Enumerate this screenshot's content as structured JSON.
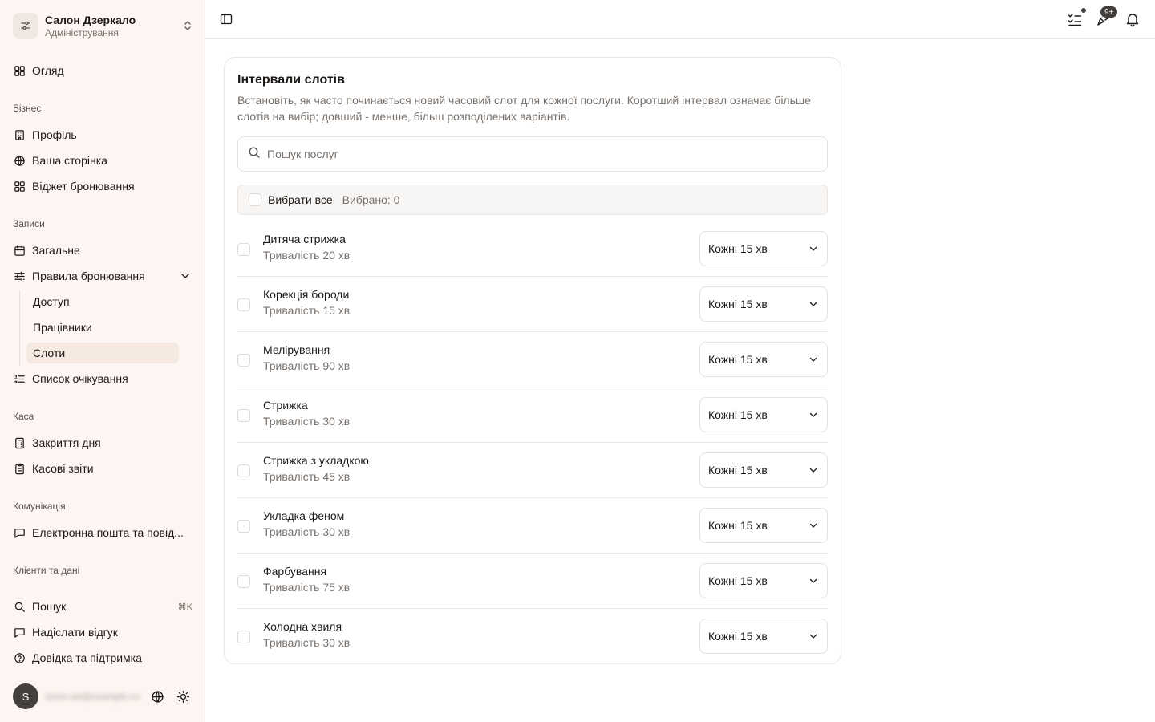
{
  "org": {
    "name": "Салон Дзеркало",
    "subtitle": "Адміністрування"
  },
  "nav": {
    "overview": "Огляд",
    "section_business": "Бізнес",
    "profile": "Профіль",
    "your_page": "Ваша сторінка",
    "booking_widget": "Віджет бронювання",
    "section_bookings": "Записи",
    "general": "Загальне",
    "booking_rules": "Правила бронювання",
    "sub_access": "Доступ",
    "sub_workers": "Працівники",
    "sub_slots": "Слоти",
    "waitlist": "Список очікування",
    "section_cash": "Каса",
    "day_close": "Закриття дня",
    "cash_reports": "Касові звіти",
    "section_comms": "Комунікація",
    "email": "Електронна пошта та повід...",
    "section_clients": "Клієнти та дані",
    "search": "Пошук",
    "search_kbd": "⌘K",
    "feedback": "Надіслати відгук",
    "help": "Довідка та підтримка"
  },
  "user": {
    "initial": "S",
    "email": "stoss-ad@example.com"
  },
  "topbar": {
    "badge": "9+"
  },
  "card": {
    "title": "Інтервали слотів",
    "description": "Встановіть, як часто починається новий часовий слот для кожної послуги. Коротший інтервал означає більше слотів на вибір; довший - менше, більш розподілених варіантів.",
    "search_placeholder": "Пошук послуг",
    "select_all": "Вибрати все",
    "selected_count": "Вибрано: 0"
  },
  "services": [
    {
      "name": "Дитяча стрижка",
      "duration": "Тривалість 20 хв",
      "interval": "Кожні 15 хв"
    },
    {
      "name": "Корекція бороди",
      "duration": "Тривалість 15 хв",
      "interval": "Кожні 15 хв"
    },
    {
      "name": "Мелірування",
      "duration": "Тривалість 90 хв",
      "interval": "Кожні 15 хв"
    },
    {
      "name": "Стрижка",
      "duration": "Тривалість 30 хв",
      "interval": "Кожні 15 хв"
    },
    {
      "name": "Стрижка з укладкою",
      "duration": "Тривалість 45 хв",
      "interval": "Кожні 15 хв"
    },
    {
      "name": "Укладка феном",
      "duration": "Тривалість 30 хв",
      "interval": "Кожні 15 хв"
    },
    {
      "name": "Фарбування",
      "duration": "Тривалість 75 хв",
      "interval": "Кожні 15 хв"
    },
    {
      "name": "Холодна хвиля",
      "duration": "Тривалість 30 хв",
      "interval": "Кожні 15 хв"
    }
  ],
  "colors": {
    "sidebar_bg": "#fdf5f1",
    "accent_active": "#f6e9e2",
    "badge": "#44403c"
  }
}
